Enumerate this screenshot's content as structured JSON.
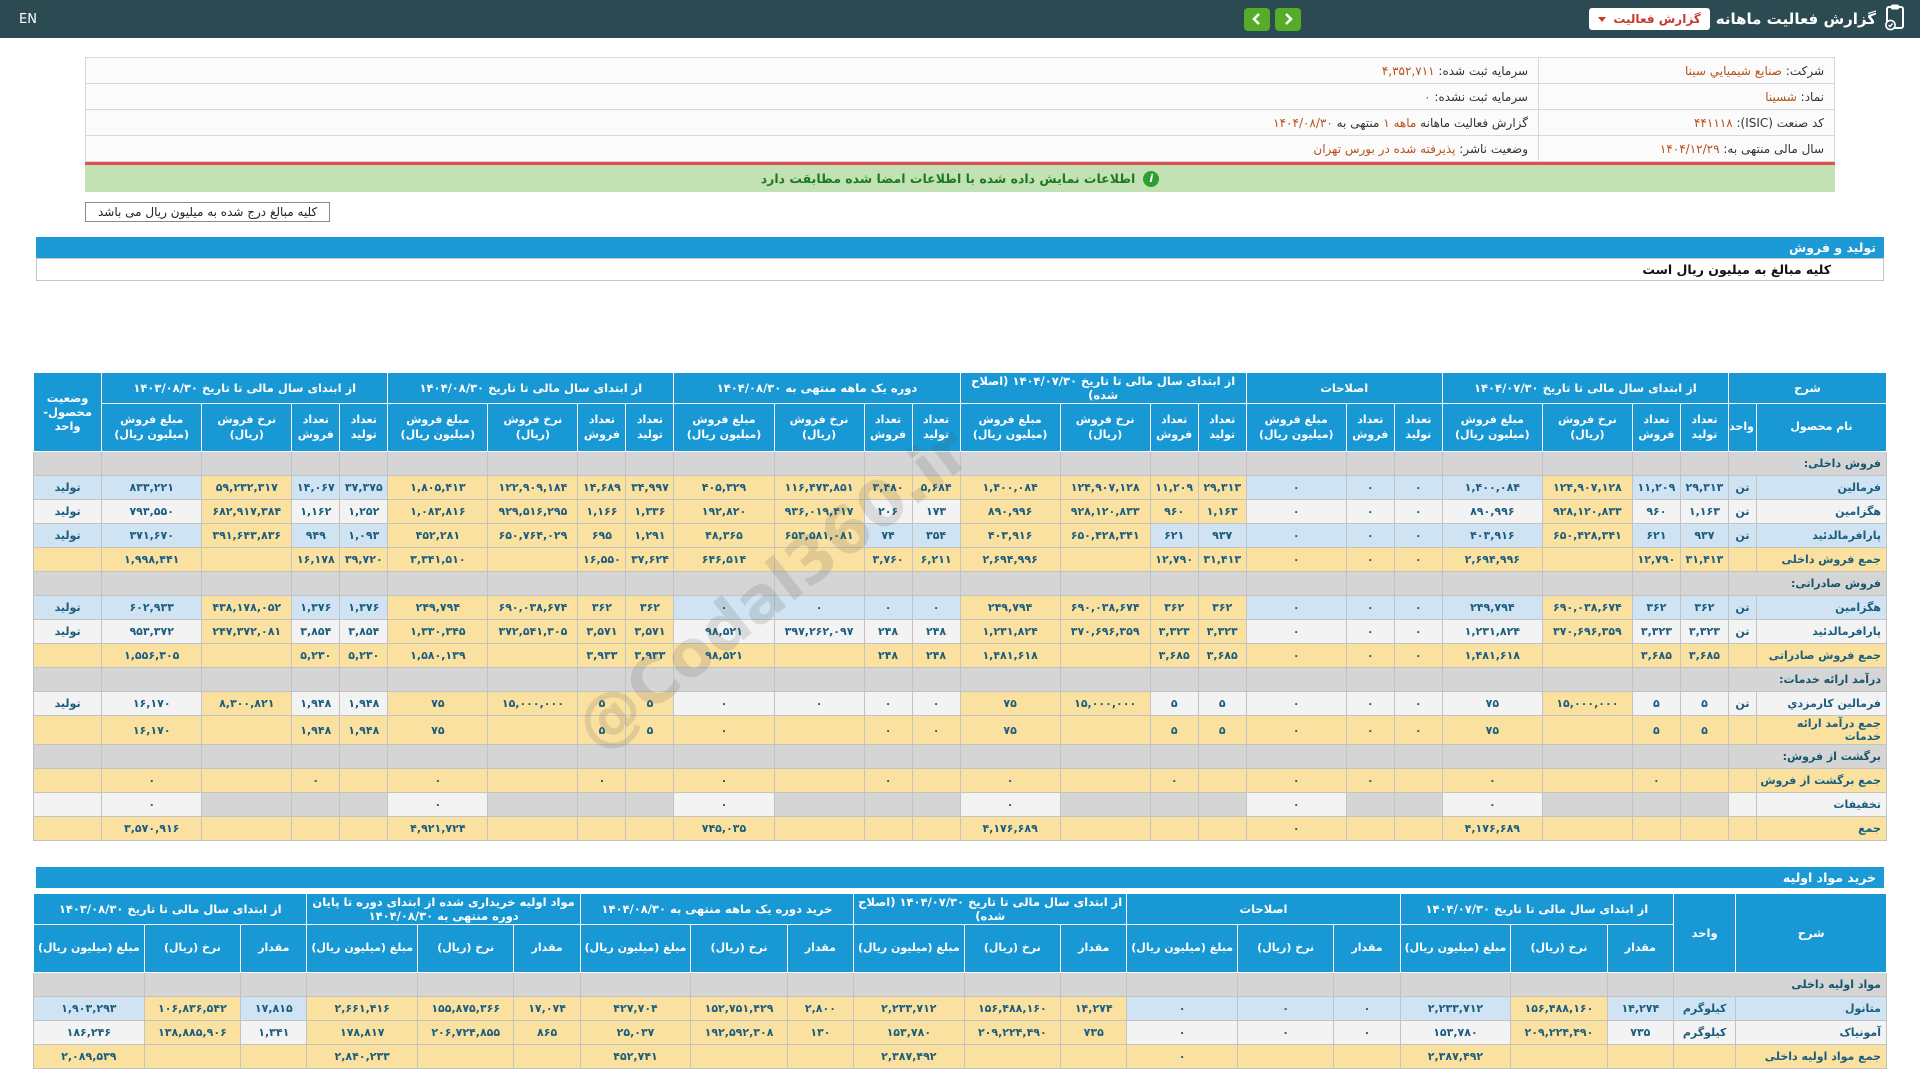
{
  "topbar": {
    "title": "گزارش فعالیت ماهانه",
    "dropdown_label": "گزارش فعالیت",
    "lang_toggle": "EN"
  },
  "info": {
    "rows": [
      {
        "r": [
          {
            "t": "شرکت: "
          },
          {
            "t": "صنایع شیمیايي سینا",
            "o": 1
          }
        ],
        "l": [
          {
            "t": "سرمایه ثبت شده: "
          },
          {
            "t": "۴,۳۵۲,۷۱۱",
            "o": 1
          }
        ]
      },
      {
        "r": [
          {
            "t": "نماد: "
          },
          {
            "t": "شسینا",
            "o": 1
          }
        ],
        "l": [
          {
            "t": "سرمایه ثبت نشده: "
          },
          {
            "t": "۰",
            "o": 1
          }
        ]
      },
      {
        "r": [
          {
            "t": "کد صنعت (ISIC): "
          },
          {
            "t": "۴۴۱۱۱۸",
            "o": 1
          }
        ],
        "l": [
          {
            "t": "گزارش فعالیت ماهانه "
          },
          {
            "t": "۱ ماهه",
            "o": 1
          },
          {
            "t": " منتهی به "
          },
          {
            "t": "۱۴۰۴/۰۸/۳۰",
            "o": 1
          }
        ]
      },
      {
        "r": [
          {
            "t": "سال مالی منتهی به: "
          },
          {
            "t": "۱۴۰۴/۱۲/۲۹",
            "o": 1
          }
        ],
        "l": [
          {
            "t": "وضعیت ناشر: "
          },
          {
            "t": "پذیرفته شده در بورس تهران",
            "o": 1
          }
        ]
      }
    ]
  },
  "notice": "اطلاعات نمایش داده شده با اطلاعات امضا شده مطابقت دارد",
  "unit_note": "کلیه مبالغ درج شده به میلیون ریال می باشد",
  "watermark": "@Codal360.ir",
  "section1": {
    "title": "تولید و فروش",
    "subtitle": "کلیه مبالغ به میلیون ریال است"
  },
  "section2": {
    "title": "خرید مواد اولیه"
  },
  "table1": {
    "widths": [
      130,
      28,
      48,
      48,
      90,
      100,
      48,
      48,
      100,
      48,
      48,
      90,
      100,
      48,
      48,
      90,
      100,
      48,
      48,
      90,
      100,
      48,
      48,
      90,
      100,
      68
    ],
    "head1": [
      {
        "t": "شرح",
        "c": 2
      },
      {
        "t": "از ابتدای سال مالی تا تاریخ ۱۴۰۴/۰۷/۳۰",
        "c": 4
      },
      {
        "t": "اصلاحات",
        "c": 3
      },
      {
        "t": "از ابتدای سال مالی تا تاریخ ۱۴۰۴/۰۷/۳۰ (اصلاح شده)",
        "c": 4
      },
      {
        "t": "دوره یک ماهه منتهی به ۱۴۰۴/۰۸/۳۰",
        "c": 4
      },
      {
        "t": "از ابتدای سال مالی تا تاریخ ۱۴۰۴/۰۸/۳۰",
        "c": 4
      },
      {
        "t": "از ابتدای سال مالی تا تاریخ ۱۴۰۳/۰۸/۳۰",
        "c": 4
      },
      {
        "t": "وضعیت محصول-واحد",
        "r": 2
      }
    ],
    "head2": [
      "نام محصول",
      "واحد",
      "تعداد تولید",
      "تعداد فروش",
      "نرخ فروش (ریال)",
      "مبلغ فروش (میلیون ریال)",
      "تعداد تولید",
      "تعداد فروش",
      "مبلغ فروش (میلیون ریال)",
      "تعداد تولید",
      "تعداد فروش",
      "نرخ فروش (ریال)",
      "مبلغ فروش (میلیون ریال)",
      "تعداد تولید",
      "تعداد فروش",
      "نرخ فروش (ریال)",
      "مبلغ فروش (میلیون ریال)",
      "تعداد تولید",
      "تعداد فروش",
      "نرخ فروش (ریال)",
      "مبلغ فروش (میلیون ریال)",
      "تعداد تولید",
      "تعداد فروش",
      "نرخ فروش (ریال)",
      "مبلغ فروش (میلیون ریال)"
    ],
    "rows": [
      {
        "k": "group",
        "label": "فروش داخلی:"
      },
      {
        "k": "data",
        "tone": "b",
        "label": "فرمالین",
        "unit": "تن",
        "status": "تولید",
        "cells": [
          "۲۹,۳۱۳",
          "۱۱,۲۰۹",
          [
            "۱۲۴,۹۰۷,۱۲۸",
            "y"
          ],
          "۱,۴۰۰,۰۸۴",
          "۰",
          "۰",
          "۰",
          [
            "۲۹,۳۱۳",
            "y"
          ],
          [
            "۱۱,۲۰۹",
            "y"
          ],
          [
            "۱۲۴,۹۰۷,۱۲۸",
            "y"
          ],
          [
            "۱,۴۰۰,۰۸۴",
            "y"
          ],
          [
            "۵,۶۸۴",
            "y"
          ],
          [
            "۳,۴۸۰",
            "y"
          ],
          [
            "۱۱۶,۴۷۳,۸۵۱",
            "y"
          ],
          [
            "۴۰۵,۳۲۹",
            "y"
          ],
          [
            "۳۴,۹۹۷",
            "y"
          ],
          [
            "۱۴,۶۸۹",
            "y"
          ],
          [
            "۱۲۲,۹۰۹,۱۸۴",
            "y"
          ],
          [
            "۱,۸۰۵,۴۱۳",
            "y"
          ],
          "۳۷,۳۷۵",
          "۱۴,۰۶۷",
          [
            "۵۹,۲۳۲,۳۱۷",
            "y"
          ],
          "۸۳۳,۲۲۱"
        ]
      },
      {
        "k": "data",
        "tone": "w",
        "label": "هگزامین",
        "unit": "تن",
        "status": "تولید",
        "cells": [
          "۱,۱۶۳",
          "۹۶۰",
          [
            "۹۲۸,۱۲۰,۸۳۳",
            "y"
          ],
          "۸۹۰,۹۹۶",
          "۰",
          "۰",
          "۰",
          [
            "۱,۱۶۳",
            "y"
          ],
          [
            "۹۶۰",
            "y"
          ],
          [
            "۹۲۸,۱۲۰,۸۳۳",
            "y"
          ],
          [
            "۸۹۰,۹۹۶",
            "y"
          ],
          "۱۷۳",
          "۲۰۶",
          [
            "۹۳۶,۰۱۹,۴۱۷",
            "y"
          ],
          [
            "۱۹۲,۸۲۰",
            "y"
          ],
          [
            "۱,۳۳۶",
            "y"
          ],
          [
            "۱,۱۶۶",
            "y"
          ],
          [
            "۹۲۹,۵۱۶,۲۹۵",
            "y"
          ],
          [
            "۱,۰۸۳,۸۱۶",
            "y"
          ],
          "۱,۲۵۲",
          "۱,۱۶۲",
          [
            "۶۸۲,۹۱۷,۳۸۴",
            "y"
          ],
          "۷۹۳,۵۵۰"
        ]
      },
      {
        "k": "data",
        "tone": "b",
        "label": "پارافرمالدئید",
        "unit": "تن",
        "status": "تولید",
        "cells": [
          "۹۳۷",
          "۶۲۱",
          [
            "۶۵۰,۴۲۸,۳۴۱",
            "y"
          ],
          "۴۰۳,۹۱۶",
          "۰",
          "۰",
          "۰",
          "۹۳۷",
          "۶۲۱",
          [
            "۶۵۰,۴۲۸,۳۴۱",
            "y"
          ],
          [
            "۴۰۳,۹۱۶",
            "y"
          ],
          "۳۵۴",
          "۷۴",
          [
            "۶۵۳,۵۸۱,۰۸۱",
            "y"
          ],
          [
            "۴۸,۳۶۵",
            "y"
          ],
          [
            "۱,۲۹۱",
            "y"
          ],
          [
            "۶۹۵",
            "y"
          ],
          [
            "۶۵۰,۷۶۴,۰۲۹",
            "y"
          ],
          [
            "۴۵۲,۲۸۱",
            "y"
          ],
          "۱,۰۹۳",
          "۹۴۹",
          [
            "۳۹۱,۶۴۳,۸۳۶",
            "y"
          ],
          "۳۷۱,۶۷۰"
        ]
      },
      {
        "k": "sum",
        "label": "جمع فروش داخلی",
        "unit": "",
        "status": "",
        "cells": [
          "۳۱,۴۱۳",
          "۱۲,۷۹۰",
          "",
          "۲,۶۹۴,۹۹۶",
          "۰",
          "۰",
          "۰",
          "۳۱,۴۱۳",
          "۱۲,۷۹۰",
          "",
          "۲,۶۹۴,۹۹۶",
          "۶,۲۱۱",
          "۳,۷۶۰",
          "",
          "۶۴۶,۵۱۴",
          "۳۷,۶۲۴",
          "۱۶,۵۵۰",
          "",
          "۳,۳۴۱,۵۱۰",
          "۳۹,۷۲۰",
          "۱۶,۱۷۸",
          "",
          "۱,۹۹۸,۴۴۱"
        ]
      },
      {
        "k": "group",
        "label": "فروش صادراتی:"
      },
      {
        "k": "data",
        "tone": "b",
        "label": "هگزامین",
        "unit": "تن",
        "status": "تولید",
        "cells": [
          "۳۶۲",
          "۳۶۲",
          [
            "۶۹۰,۰۳۸,۶۷۴",
            "y"
          ],
          "۲۴۹,۷۹۴",
          "۰",
          "۰",
          "۰",
          [
            "۳۶۲",
            "y"
          ],
          [
            "۳۶۲",
            "y"
          ],
          [
            "۶۹۰,۰۳۸,۶۷۴",
            "y"
          ],
          [
            "۲۴۹,۷۹۴",
            "y"
          ],
          "۰",
          "۰",
          "۰",
          "۰",
          [
            "۳۶۲",
            "y"
          ],
          [
            "۳۶۲",
            "y"
          ],
          [
            "۶۹۰,۰۳۸,۶۷۴",
            "y"
          ],
          [
            "۲۴۹,۷۹۴",
            "y"
          ],
          "۱,۳۷۶",
          "۱,۳۷۶",
          [
            "۴۳۸,۱۷۸,۰۵۲",
            "y"
          ],
          "۶۰۲,۹۳۳"
        ]
      },
      {
        "k": "data",
        "tone": "w",
        "label": "پارافرمالدئید",
        "unit": "تن",
        "status": "تولید",
        "cells": [
          "۳,۳۲۳",
          "۳,۳۲۳",
          [
            "۳۷۰,۶۹۶,۳۵۹",
            "y"
          ],
          "۱,۲۳۱,۸۲۴",
          "۰",
          "۰",
          "۰",
          [
            "۳,۳۲۳",
            "y"
          ],
          [
            "۳,۳۲۳",
            "y"
          ],
          [
            "۳۷۰,۶۹۶,۳۵۹",
            "y"
          ],
          [
            "۱,۲۳۱,۸۲۴",
            "y"
          ],
          "۲۴۸",
          "۲۴۸",
          "۳۹۷,۲۶۲,۰۹۷",
          "۹۸,۵۲۱",
          [
            "۳,۵۷۱",
            "y"
          ],
          [
            "۳,۵۷۱",
            "y"
          ],
          [
            "۳۷۲,۵۴۱,۳۰۵",
            "y"
          ],
          [
            "۱,۳۳۰,۳۴۵",
            "y"
          ],
          "۳,۸۵۴",
          "۳,۸۵۴",
          [
            "۲۴۷,۳۷۲,۰۸۱",
            "y"
          ],
          "۹۵۳,۳۷۲"
        ]
      },
      {
        "k": "sum",
        "label": "جمع فروش صادراتی",
        "unit": "",
        "status": "",
        "cells": [
          "۳,۶۸۵",
          "۳,۶۸۵",
          "",
          "۱,۴۸۱,۶۱۸",
          "۰",
          "۰",
          "۰",
          "۳,۶۸۵",
          "۳,۶۸۵",
          "",
          "۱,۴۸۱,۶۱۸",
          "۲۴۸",
          "۲۴۸",
          "",
          "۹۸,۵۲۱",
          "۳,۹۳۳",
          "۳,۹۳۳",
          "",
          "۱,۵۸۰,۱۳۹",
          "۵,۲۳۰",
          "۵,۲۳۰",
          "",
          "۱,۵۵۶,۳۰۵"
        ]
      },
      {
        "k": "group",
        "label": "درآمد ارائه خدمات:"
      },
      {
        "k": "data",
        "tone": "w",
        "label": "فرمالین کارمزدي",
        "unit": "تن",
        "status": "تولید",
        "cells": [
          "۵",
          "۵",
          [
            "۱۵,۰۰۰,۰۰۰",
            "y"
          ],
          "۷۵",
          "۰",
          "۰",
          "۰",
          "۵",
          "۵",
          [
            "۱۵,۰۰۰,۰۰۰",
            "y"
          ],
          [
            "۷۵",
            "y"
          ],
          "۰",
          "۰",
          "۰",
          "۰",
          [
            "۵",
            "y"
          ],
          [
            "۵",
            "y"
          ],
          [
            "۱۵,۰۰۰,۰۰۰",
            "y"
          ],
          [
            "۷۵",
            "y"
          ],
          "۱,۹۴۸",
          "۱,۹۴۸",
          [
            "۸,۳۰۰,۸۲۱",
            "y"
          ],
          "۱۶,۱۷۰"
        ]
      },
      {
        "k": "sum",
        "label": "جمع درآمد ارائه خدمات",
        "unit": "",
        "status": "",
        "cells": [
          "۵",
          "۵",
          "",
          "۷۵",
          "۰",
          "۰",
          "۰",
          "۵",
          "۵",
          "",
          "۷۵",
          "۰",
          "۰",
          "",
          "۰",
          "۵",
          "۵",
          "",
          "۷۵",
          "۱,۹۴۸",
          "۱,۹۴۸",
          "",
          "۱۶,۱۷۰"
        ]
      },
      {
        "k": "group",
        "label": "برگشت از فروش:"
      },
      {
        "k": "sum",
        "label": "جمع برگشت از فروش",
        "unit": "",
        "status": "",
        "cells": [
          "",
          "۰",
          "",
          "۰",
          "",
          "۰",
          "۰",
          "",
          "۰",
          "",
          "۰",
          "",
          "۰",
          "",
          "۰",
          "",
          "۰",
          "",
          "۰",
          "",
          "۰",
          "",
          "۰"
        ]
      },
      {
        "k": "data",
        "tone": "w",
        "label": "تخفیفات",
        "unit": "",
        "status": "",
        "cells": [
          [
            "",
            "d"
          ],
          [
            "",
            "d"
          ],
          [
            "",
            "d"
          ],
          "۰",
          [
            "",
            "d"
          ],
          [
            "",
            "d"
          ],
          "۰",
          [
            "",
            "d"
          ],
          [
            "",
            "d"
          ],
          [
            "",
            "d"
          ],
          "۰",
          [
            "",
            "d"
          ],
          [
            "",
            "d"
          ],
          [
            "",
            "d"
          ],
          "۰",
          [
            "",
            "d"
          ],
          [
            "",
            "d"
          ],
          [
            "",
            "d"
          ],
          "۰",
          [
            "",
            "d"
          ],
          [
            "",
            "d"
          ],
          [
            "",
            "d"
          ],
          "۰"
        ]
      },
      {
        "k": "sum",
        "label": "جمع",
        "unit": "",
        "status": "",
        "cells": [
          "",
          "",
          "",
          "۴,۱۷۶,۶۸۹",
          "",
          "",
          "۰",
          "",
          "",
          "",
          "۴,۱۷۶,۶۸۹",
          "",
          "",
          "",
          "۷۴۵,۰۳۵",
          "",
          "",
          "",
          "۴,۹۲۱,۷۲۴",
          "",
          "",
          "",
          "۳,۵۷۰,۹۱۶"
        ]
      }
    ]
  },
  "table2": {
    "widths": [
      150,
      62,
      66,
      96,
      110,
      66,
      96,
      110,
      66,
      96,
      110,
      66,
      96,
      110,
      66,
      96,
      110,
      66,
      96,
      110
    ],
    "head1": [
      {
        "t": "شرح",
        "r": 2
      },
      {
        "t": "واحد",
        "r": 2
      },
      {
        "t": "از ابتدای سال مالی تا تاریخ ۱۴۰۴/۰۷/۳۰",
        "c": 3
      },
      {
        "t": "اصلاحات",
        "c": 3
      },
      {
        "t": "از ابتدای سال مالی تا تاریخ ۱۴۰۴/۰۷/۳۰ (اصلاح شده)",
        "c": 3
      },
      {
        "t": "خرید دوره یک ماهه منتهی به ۱۴۰۴/۰۸/۳۰",
        "c": 3
      },
      {
        "t": "مواد اولیه خریداری شده از ابتدای دوره تا پایان دوره منتهی به ۱۴۰۴/۰۸/۳۰",
        "c": 3
      },
      {
        "t": "از ابتدای سال مالی تا تاریخ ۱۴۰۳/۰۸/۳۰",
        "c": 3
      }
    ],
    "head2": [
      "مقدار",
      "نرخ (ریال)",
      "مبلغ (میلیون ریال)",
      "مقدار",
      "نرخ (ریال)",
      "مبلغ (میلیون ریال)",
      "مقدار",
      "نرخ (ریال)",
      "مبلغ (میلیون ریال)",
      "مقدار",
      "نرخ (ریال)",
      "مبلغ (میلیون ریال)",
      "مقدار",
      "نرخ (ریال)",
      "مبلغ (میلیون ریال)",
      "مقدار",
      "نرخ (ریال)",
      "مبلغ (میلیون ریال)"
    ],
    "rows": [
      {
        "k": "group",
        "label": "مواد اولیه داخلی"
      },
      {
        "k": "data",
        "tone": "b",
        "label": "متانول",
        "unit": "کیلوگرم",
        "cells": [
          "۱۴,۲۷۴",
          [
            "۱۵۶,۴۸۸,۱۶۰",
            "y"
          ],
          "۲,۲۳۳,۷۱۲",
          "۰",
          "۰",
          "۰",
          [
            "۱۴,۲۷۴",
            "y"
          ],
          [
            "۱۵۶,۴۸۸,۱۶۰",
            "y"
          ],
          [
            "۲,۲۳۳,۷۱۲",
            "y"
          ],
          [
            "۲,۸۰۰",
            "y"
          ],
          [
            "۱۵۲,۷۵۱,۴۲۹",
            "y"
          ],
          [
            "۴۲۷,۷۰۴",
            "y"
          ],
          [
            "۱۷,۰۷۴",
            "y"
          ],
          [
            "۱۵۵,۸۷۵,۳۶۶",
            "y"
          ],
          [
            "۲,۶۶۱,۴۱۶",
            "y"
          ],
          "۱۷,۸۱۵",
          [
            "۱۰۶,۸۳۶,۵۴۲",
            "y"
          ],
          "۱,۹۰۳,۲۹۳"
        ]
      },
      {
        "k": "data",
        "tone": "w",
        "label": "آمونیاک",
        "unit": "کیلوگرم",
        "cells": [
          "۷۳۵",
          [
            "۲۰۹,۲۲۴,۴۹۰",
            "y"
          ],
          "۱۵۳,۷۸۰",
          "۰",
          "۰",
          "۰",
          [
            "۷۳۵",
            "y"
          ],
          [
            "۲۰۹,۲۲۴,۴۹۰",
            "y"
          ],
          [
            "۱۵۳,۷۸۰",
            "y"
          ],
          [
            "۱۳۰",
            "y"
          ],
          [
            "۱۹۲,۵۹۲,۳۰۸",
            "y"
          ],
          [
            "۲۵,۰۳۷",
            "y"
          ],
          [
            "۸۶۵",
            "y"
          ],
          [
            "۲۰۶,۷۲۴,۸۵۵",
            "y"
          ],
          [
            "۱۷۸,۸۱۷",
            "y"
          ],
          "۱,۳۴۱",
          [
            "۱۳۸,۸۸۵,۹۰۶",
            "y"
          ],
          "۱۸۶,۲۴۶"
        ]
      },
      {
        "k": "sum",
        "label": "جمع مواد اولیه داخلی",
        "unit": "",
        "cells": [
          "",
          "",
          "۲,۳۸۷,۴۹۲",
          "",
          "",
          "۰",
          "",
          "",
          "۲,۳۸۷,۴۹۲",
          "",
          "",
          "۴۵۲,۷۴۱",
          "",
          "",
          "۲,۸۴۰,۲۳۳",
          "",
          "",
          "۲,۰۸۹,۵۳۹"
        ]
      }
    ]
  }
}
